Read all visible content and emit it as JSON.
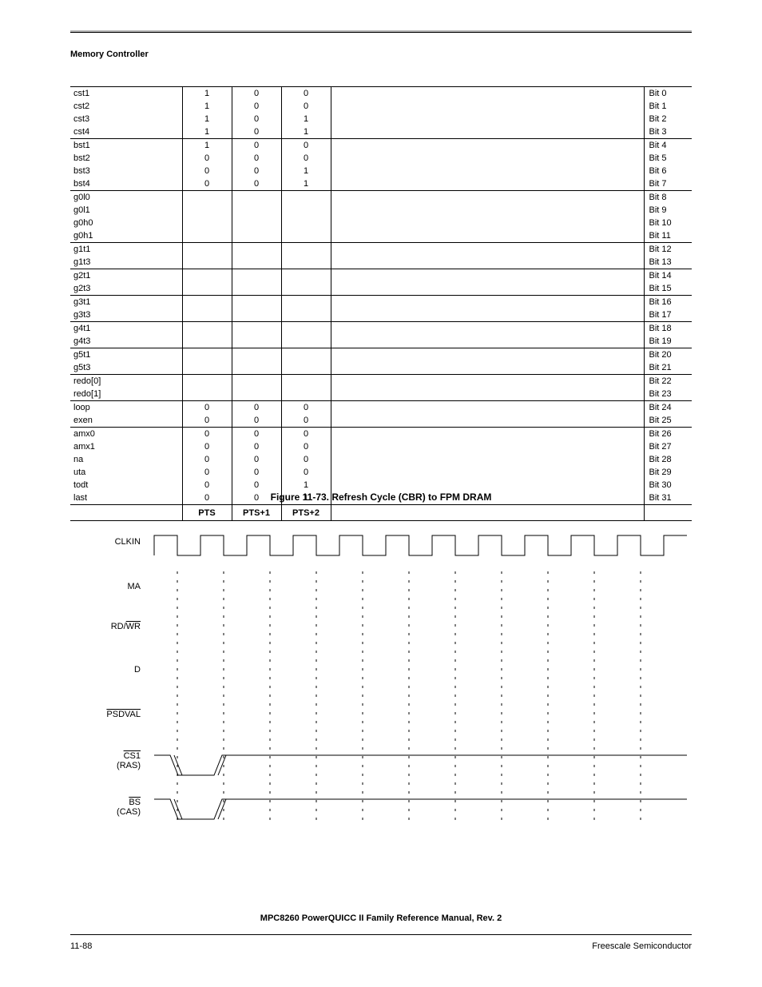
{
  "section_title": "Memory Controller",
  "table": {
    "groups": [
      {
        "rows": [
          {
            "name": "cst1",
            "pts": "1",
            "pts1": "0",
            "pts2": "0",
            "bit": "Bit 0"
          },
          {
            "name": "cst2",
            "pts": "1",
            "pts1": "0",
            "pts2": "0",
            "bit": "Bit 1"
          },
          {
            "name": "cst3",
            "pts": "1",
            "pts1": "0",
            "pts2": "1",
            "bit": "Bit 2"
          },
          {
            "name": "cst4",
            "pts": "1",
            "pts1": "0",
            "pts2": "1",
            "bit": "Bit 3"
          }
        ]
      },
      {
        "rows": [
          {
            "name": "bst1",
            "pts": "1",
            "pts1": "0",
            "pts2": "0",
            "bit": "Bit 4"
          },
          {
            "name": "bst2",
            "pts": "0",
            "pts1": "0",
            "pts2": "0",
            "bit": "Bit 5"
          },
          {
            "name": "bst3",
            "pts": "0",
            "pts1": "0",
            "pts2": "1",
            "bit": "Bit 6"
          },
          {
            "name": "bst4",
            "pts": "0",
            "pts1": "0",
            "pts2": "1",
            "bit": "Bit 7"
          }
        ]
      },
      {
        "rows": [
          {
            "name": "g0l0",
            "pts": "",
            "pts1": "",
            "pts2": "",
            "bit": "Bit 8"
          },
          {
            "name": "g0l1",
            "pts": "",
            "pts1": "",
            "pts2": "",
            "bit": "Bit 9"
          },
          {
            "name": "g0h0",
            "pts": "",
            "pts1": "",
            "pts2": "",
            "bit": "Bit 10"
          },
          {
            "name": "g0h1",
            "pts": "",
            "pts1": "",
            "pts2": "",
            "bit": "Bit 11"
          }
        ]
      },
      {
        "rows": [
          {
            "name": "g1t1",
            "pts": "",
            "pts1": "",
            "pts2": "",
            "bit": "Bit 12"
          },
          {
            "name": "g1t3",
            "pts": "",
            "pts1": "",
            "pts2": "",
            "bit": "Bit 13"
          }
        ]
      },
      {
        "rows": [
          {
            "name": "g2t1",
            "pts": "",
            "pts1": "",
            "pts2": "",
            "bit": "Bit 14"
          },
          {
            "name": "g2t3",
            "pts": "",
            "pts1": "",
            "pts2": "",
            "bit": "Bit 15"
          }
        ]
      },
      {
        "rows": [
          {
            "name": "g3t1",
            "pts": "",
            "pts1": "",
            "pts2": "",
            "bit": "Bit 16"
          },
          {
            "name": "g3t3",
            "pts": "",
            "pts1": "",
            "pts2": "",
            "bit": "Bit 17"
          }
        ]
      },
      {
        "rows": [
          {
            "name": "g4t1",
            "pts": "",
            "pts1": "",
            "pts2": "",
            "bit": "Bit 18"
          },
          {
            "name": "g4t3",
            "pts": "",
            "pts1": "",
            "pts2": "",
            "bit": "Bit 19"
          }
        ]
      },
      {
        "rows": [
          {
            "name": "g5t1",
            "pts": "",
            "pts1": "",
            "pts2": "",
            "bit": "Bit 20"
          },
          {
            "name": "g5t3",
            "pts": "",
            "pts1": "",
            "pts2": "",
            "bit": "Bit 21"
          }
        ]
      },
      {
        "rows": [
          {
            "name": "redo[0]",
            "pts": "",
            "pts1": "",
            "pts2": "",
            "bit": "Bit 22"
          },
          {
            "name": "redo[1]",
            "pts": "",
            "pts1": "",
            "pts2": "",
            "bit": "Bit 23"
          }
        ]
      },
      {
        "rows": [
          {
            "name": "loop",
            "pts": "0",
            "pts1": "0",
            "pts2": "0",
            "bit": "Bit 24"
          },
          {
            "name": "exen",
            "pts": "0",
            "pts1": "0",
            "pts2": "0",
            "bit": "Bit 25"
          }
        ]
      },
      {
        "rows": [
          {
            "name": "amx0",
            "pts": "0",
            "pts1": "0",
            "pts2": "0",
            "bit": "Bit 26"
          },
          {
            "name": "amx1",
            "pts": "0",
            "pts1": "0",
            "pts2": "0",
            "bit": "Bit 27"
          },
          {
            "name": "na",
            "pts": "0",
            "pts1": "0",
            "pts2": "0",
            "bit": "Bit 28"
          },
          {
            "name": "uta",
            "pts": "0",
            "pts1": "0",
            "pts2": "0",
            "bit": "Bit 29"
          },
          {
            "name": "todt",
            "pts": "0",
            "pts1": "0",
            "pts2": "1",
            "bit": "Bit 30"
          },
          {
            "name": "last",
            "pts": "0",
            "pts1": "0",
            "pts2": "1",
            "bit": "Bit 31"
          }
        ]
      }
    ],
    "footer": {
      "c1": "",
      "c2": "PTS",
      "c3": "PTS+1",
      "c4": "PTS+2",
      "c5": "",
      "c6": ""
    }
  },
  "figure_caption": "Figure 11-73. Refresh Cycle (CBR) to FPM DRAM",
  "timing": {
    "signals": [
      {
        "label_html": "CLKIN"
      },
      {
        "label_html": "MA"
      },
      {
        "label_html": "RD/<span class='overline'>WR</span>"
      },
      {
        "label_html": "D"
      },
      {
        "label_html": "<span class='overline'>PSDVAL</span>"
      },
      {
        "label_html": "<span class='overline'>CS1</span><br>(RAS)"
      },
      {
        "label_html": "<span class='overline'>BS</span><br>(CAS)"
      }
    ]
  },
  "manual_ref": "MPC8260 PowerQUICC II Family Reference Manual, Rev. 2",
  "page_number": "11-88",
  "vendor": "Freescale Semiconductor"
}
